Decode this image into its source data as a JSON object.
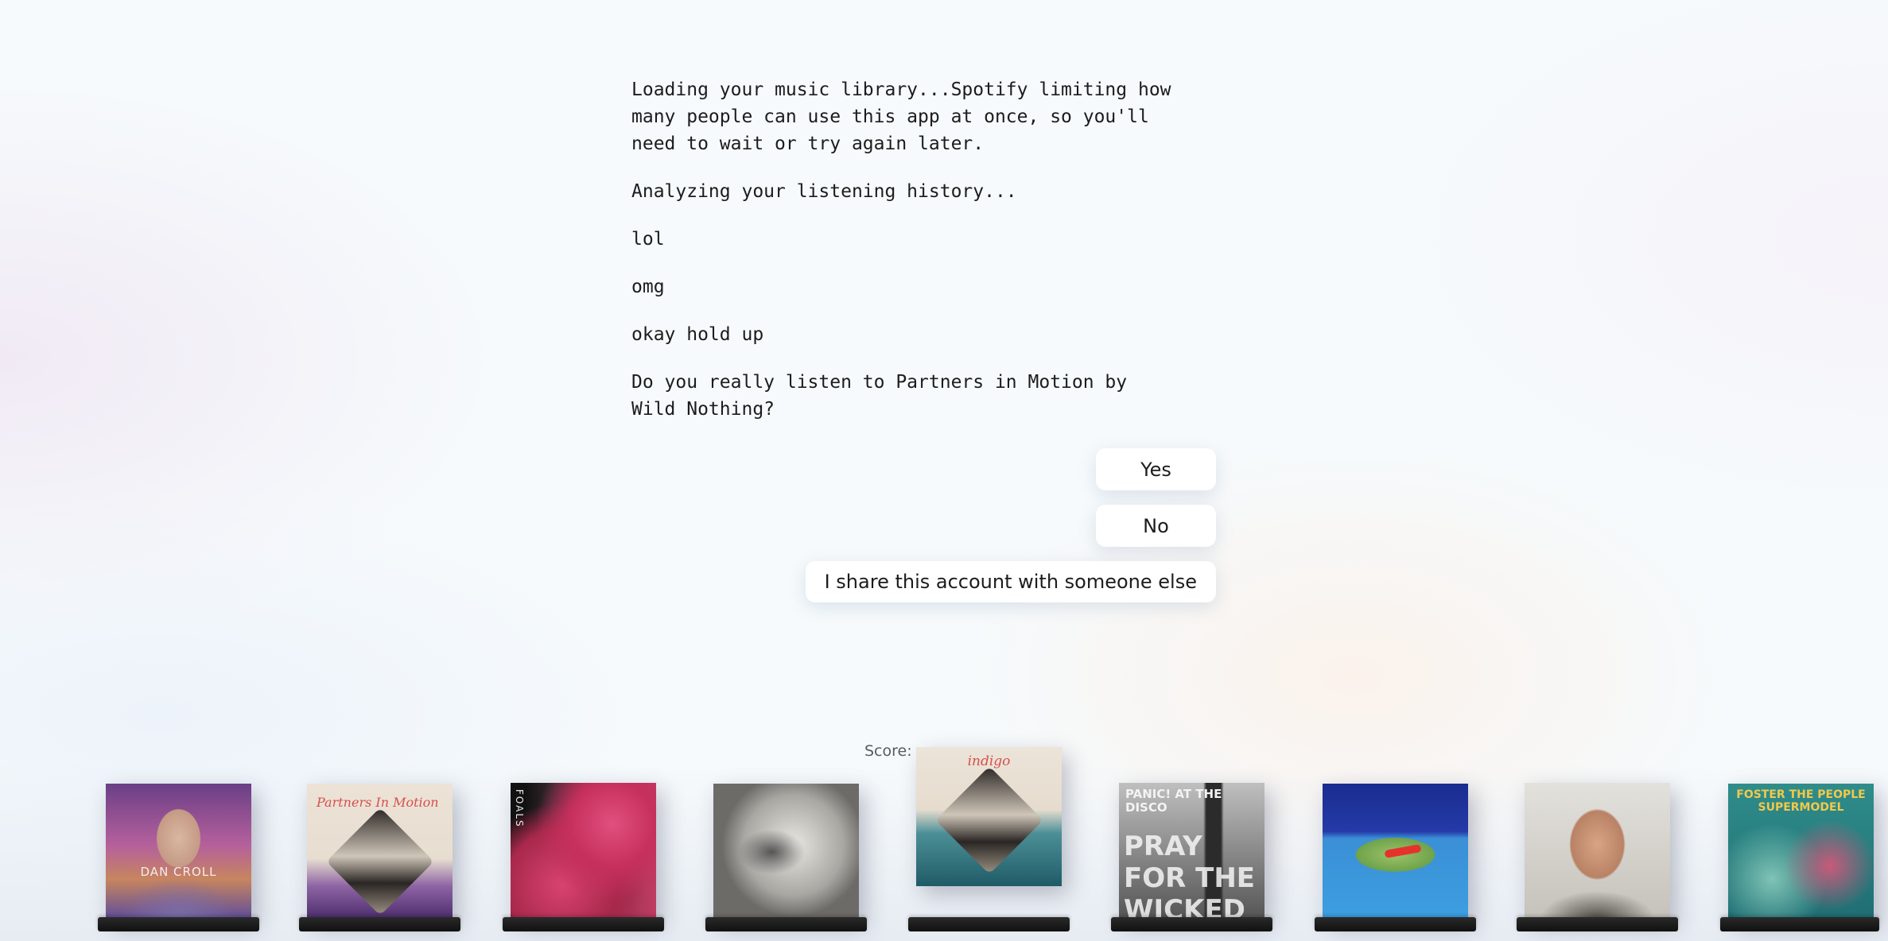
{
  "conversation": {
    "messages": [
      "Loading your music library...Spotify limiting how many people can use this app at once, so you'll need to wait or try again later.",
      "Analyzing your listening history...",
      "lol",
      "omg",
      "okay hold up",
      "Do you really listen to Partners in Motion by Wild Nothing?"
    ]
  },
  "choices": {
    "yes": "Yes",
    "no": "No",
    "share": "I share this account with someone else"
  },
  "score": {
    "label": "Score:"
  },
  "albums": [
    {
      "name": "Dan Croll album",
      "cover_text": "DAN CROLL"
    },
    {
      "name": "Partners in Motion",
      "cover_text": "Partners In Motion"
    },
    {
      "name": "Foals album",
      "cover_text": "FOALS"
    },
    {
      "name": "Wild Nothing album",
      "cover_text": ""
    },
    {
      "name": "Indigo",
      "cover_text": "indigo"
    },
    {
      "name": "Pray for the Wicked",
      "cover_text": "PANIC! AT THE DISCO",
      "cover_text_2": "PRAY FOR THE WICKED"
    },
    {
      "name": "Lily pad album",
      "cover_text": ""
    },
    {
      "name": "Portrait album",
      "cover_text": ""
    },
    {
      "name": "Supermodel",
      "cover_text": "FOSTER THE PEOPLE SUPERMODEL"
    }
  ]
}
